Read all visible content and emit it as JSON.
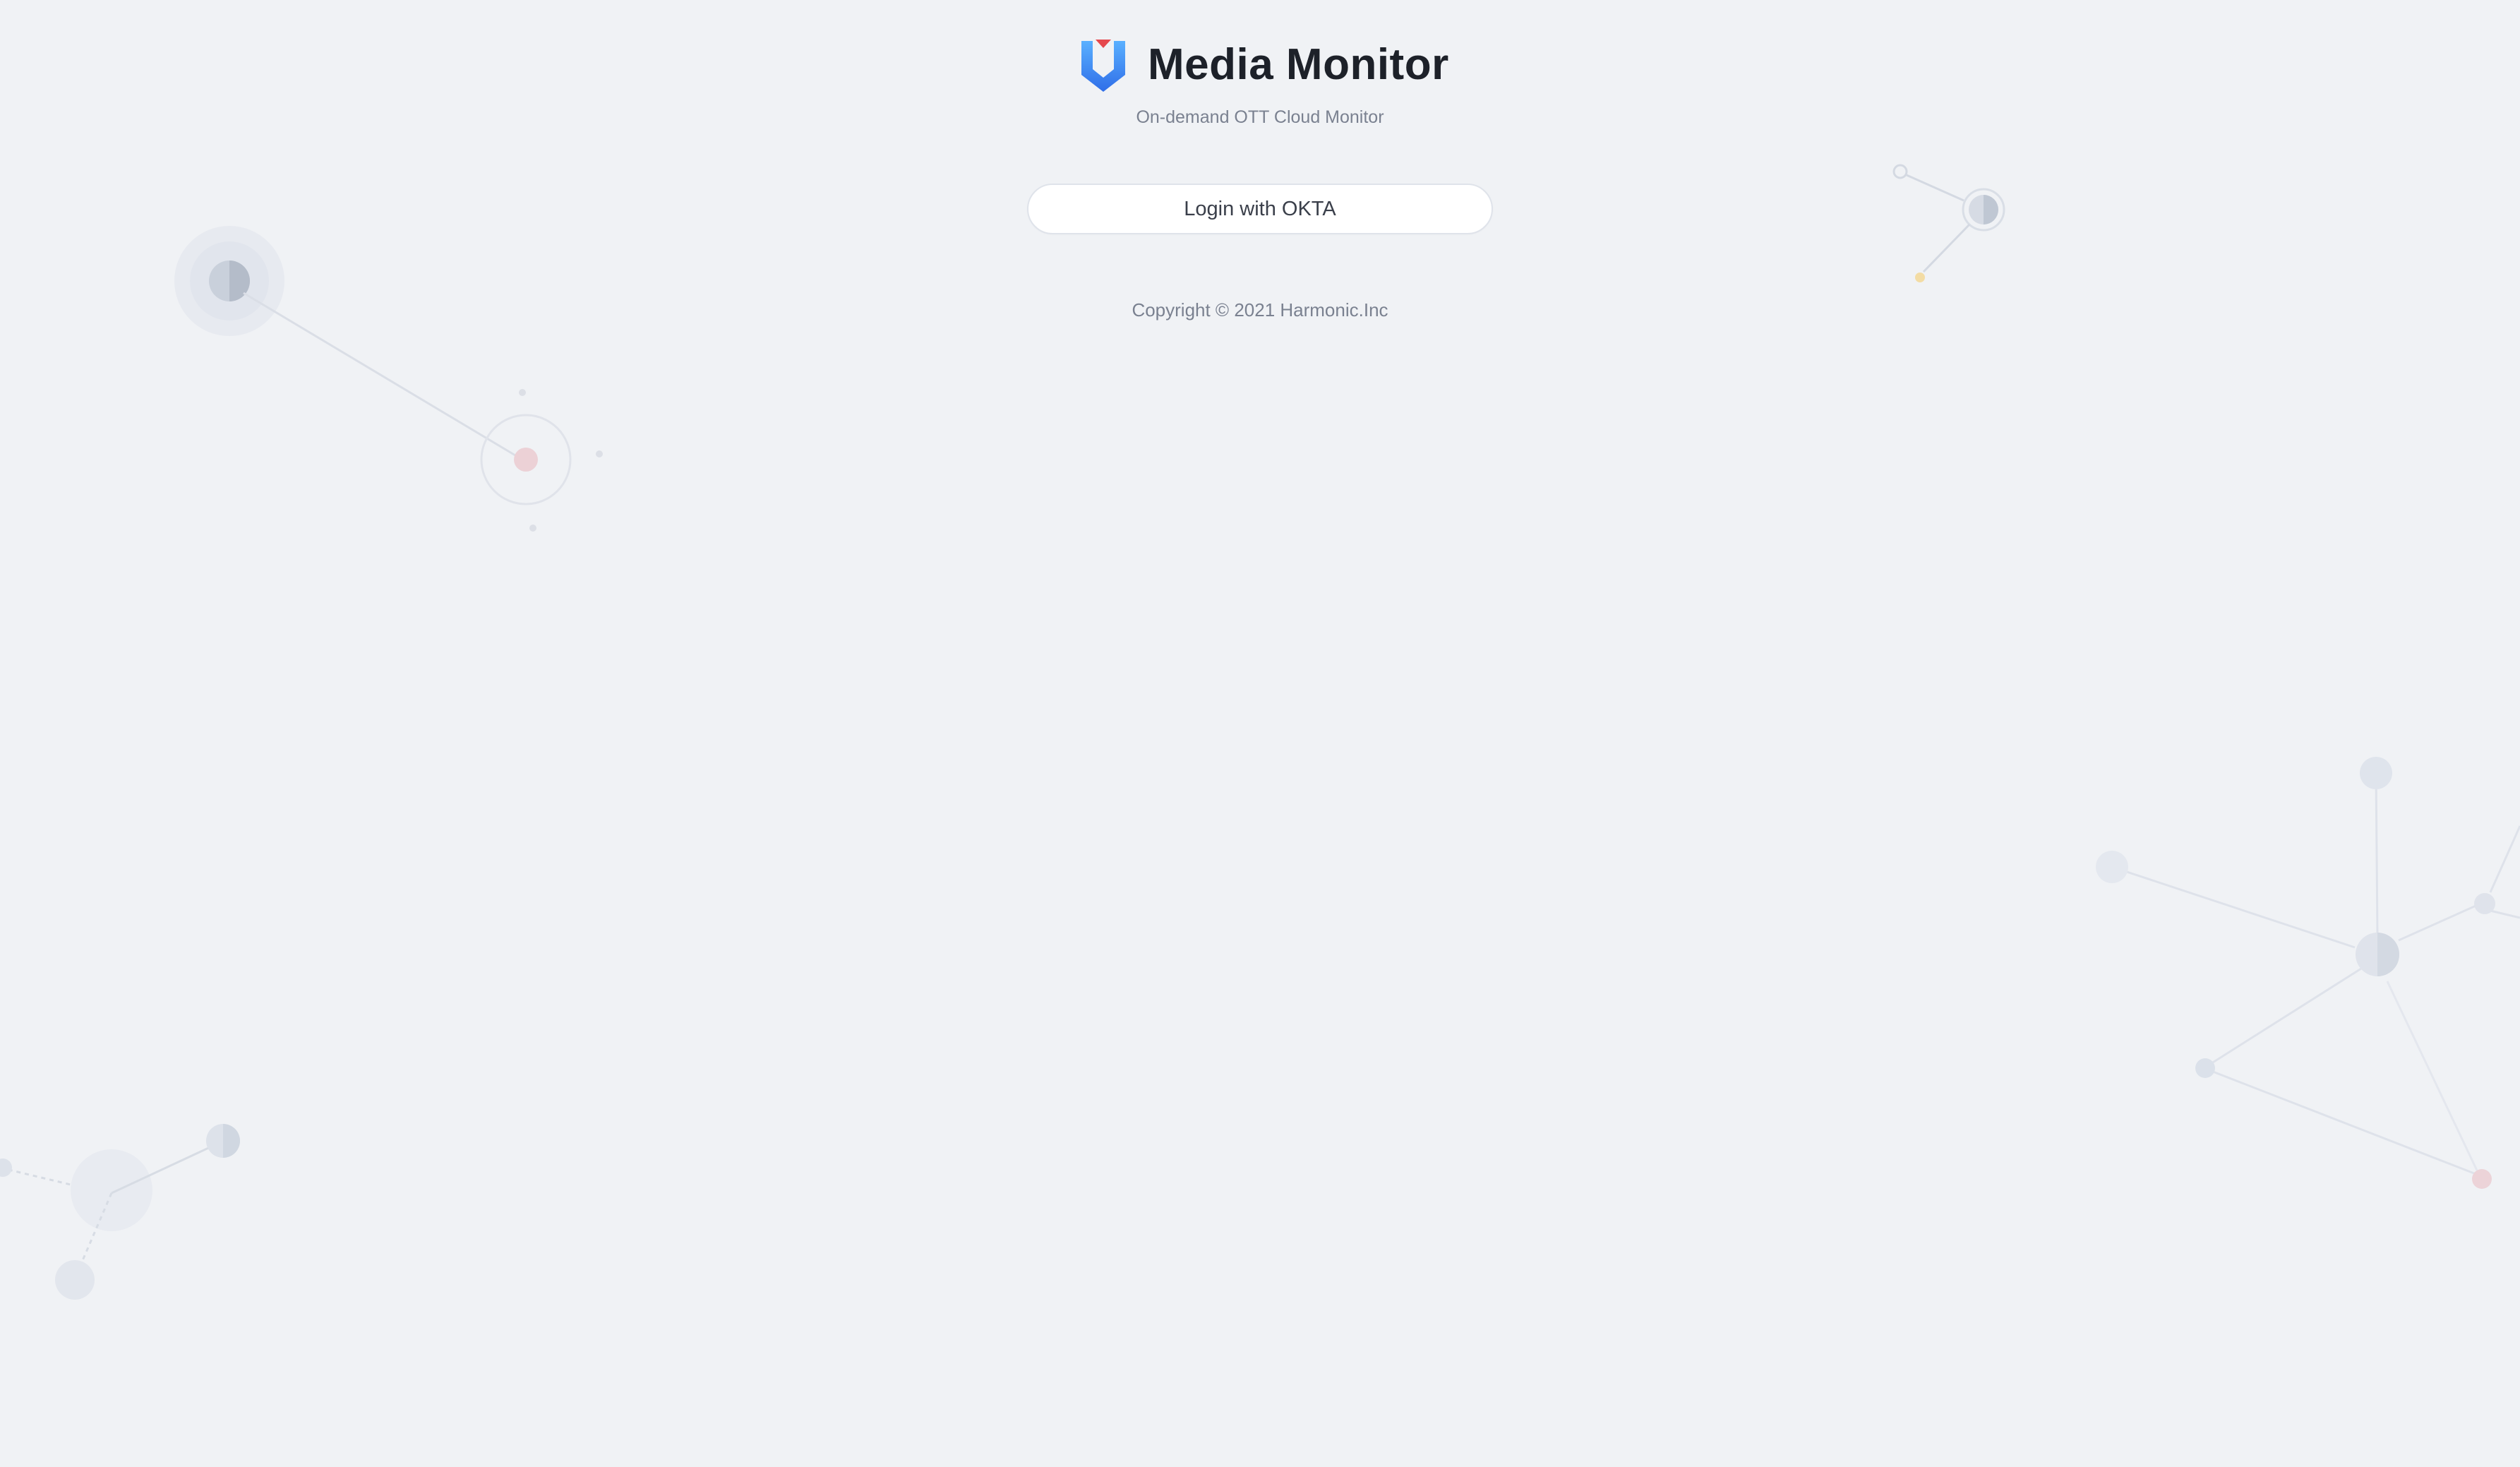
{
  "app": {
    "title": "Media Monitor",
    "subtitle": "On-demand OTT Cloud Monitor"
  },
  "login": {
    "button_label": "Login with OKTA"
  },
  "footer": {
    "copyright": "Copyright © 2021 Harmonic.Inc"
  },
  "icons": {
    "logo": "media-monitor-logo-icon"
  },
  "colors": {
    "background": "#f0f2f5",
    "title": "#1d2129",
    "muted_text": "#7a8190",
    "logo_blue": "#3b82f6",
    "logo_red": "#e5484d"
  }
}
